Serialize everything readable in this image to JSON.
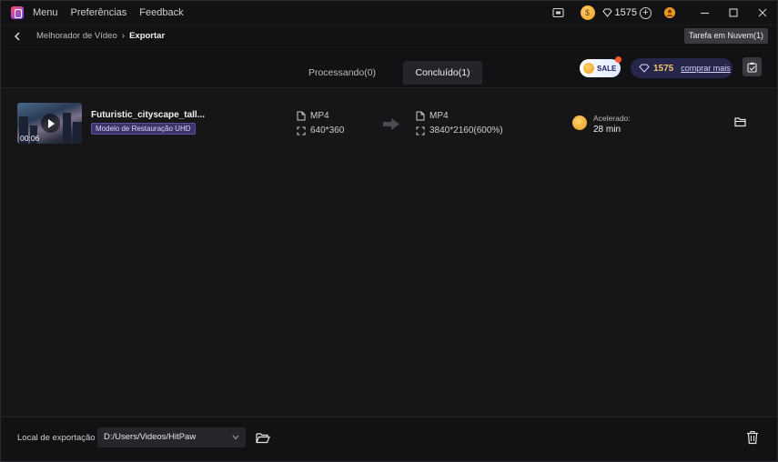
{
  "titlebar": {
    "menu": [
      "Menu",
      "Preferências",
      "Feedback"
    ],
    "credits": "1575",
    "icons": [
      "app-logo-icon",
      "screen-icon",
      "coin-icon",
      "diamond-icon",
      "plus-icon",
      "user-icon",
      "minimize-icon",
      "maximize-icon",
      "close-icon"
    ]
  },
  "breadcrumb": {
    "items": [
      "Melhorador de Vídeo",
      "Exportar"
    ],
    "cloud_task": "Tarefa em Nuvem(1)"
  },
  "tabs": [
    {
      "label": "Processando(0)",
      "active": false
    },
    {
      "label": "Concluído(1)",
      "active": true
    }
  ],
  "promo": {
    "sale_label": "SALE",
    "credits": "1575",
    "buy_more": "comprar mais"
  },
  "task": {
    "duration": "00:06",
    "file_name": "Futuristic_cityscape_tall...",
    "model": "Modelo de Restauração UHD",
    "input": {
      "format": "MP4",
      "resolution": "640*360"
    },
    "output": {
      "format": "MP4",
      "resolution": "3840*2160(600%)"
    },
    "accelerated_label": "Acelerado:",
    "accelerated_time": "28 min"
  },
  "footer": {
    "location_label": "Local de exportação",
    "path": "D:/Users/Videos/HitPaw"
  },
  "colors": {
    "background": "#161618",
    "bar": "#121214",
    "active_tab": "#24242a",
    "accent_gold": "#f0c26a",
    "badge_purple": "#3b3568"
  }
}
